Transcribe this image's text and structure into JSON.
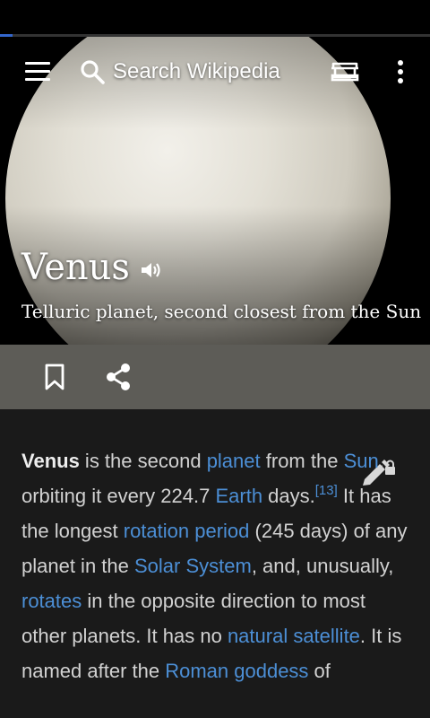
{
  "search": {
    "label": "Search Wikipedia"
  },
  "progress": {
    "fraction": 0.03
  },
  "lead": {
    "title": "Venus",
    "description": "Telluric planet, second closest from the Sun"
  },
  "icons": [
    "menu-icon",
    "search-icon",
    "reading-list-icon",
    "overflow-menu-icon",
    "speaker-icon",
    "bookmark-icon",
    "share-icon",
    "edit-locked-icon"
  ],
  "colors": {
    "link": "#4c8fd6",
    "text": "#d2d2d2",
    "background": "#1a1a1a",
    "action_bar": "#5d5c57",
    "progress": "#3366cc"
  },
  "article": {
    "segments": [
      {
        "t": "Venus",
        "k": "bold"
      },
      {
        "t": " is the second ",
        "k": "text"
      },
      {
        "t": "planet",
        "k": "link"
      },
      {
        "t": " from the ",
        "k": "text"
      },
      {
        "t": "Sun",
        "k": "link"
      },
      {
        "t": ", orbiting it every 224.7 ",
        "k": "text"
      },
      {
        "t": "Earth",
        "k": "link"
      },
      {
        "t": " days.",
        "k": "text"
      },
      {
        "t": "[13]",
        "k": "ref"
      },
      {
        "t": " It has the longest ",
        "k": "text"
      },
      {
        "t": "rotation period",
        "k": "link"
      },
      {
        "t": " (245 days) of any planet in the ",
        "k": "text"
      },
      {
        "t": "Solar System",
        "k": "link"
      },
      {
        "t": ", and, unusually, ",
        "k": "text"
      },
      {
        "t": "rotates",
        "k": "link"
      },
      {
        "t": " in the opposite direction to most other planets. It has no ",
        "k": "text"
      },
      {
        "t": "natural satellite",
        "k": "link"
      },
      {
        "t": ". It is named after the ",
        "k": "text"
      },
      {
        "t": "Roman goddess",
        "k": "link"
      },
      {
        "t": " of",
        "k": "text"
      }
    ]
  }
}
